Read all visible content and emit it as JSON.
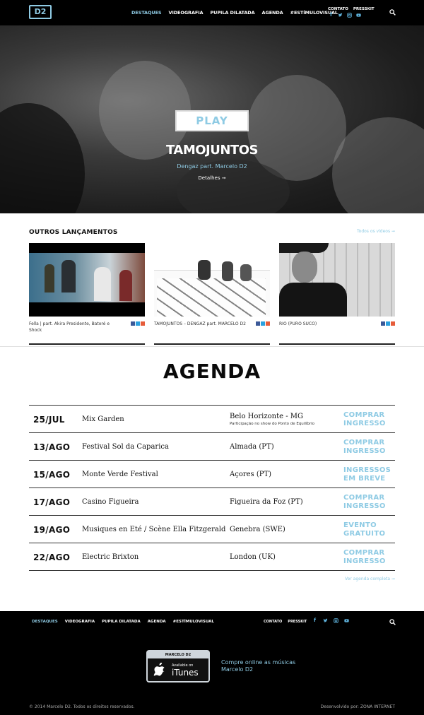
{
  "header": {
    "logo_text": "D2",
    "nav": [
      "DESTAQUES",
      "VIDEOGRAFIA",
      "PUPILA DILATADA",
      "AGENDA",
      "#ESTÍMULOVISUAL"
    ],
    "active_nav": "DESTAQUES",
    "links": [
      "CONTATO",
      "PRESSKIT"
    ],
    "social_icons": [
      "facebook-icon",
      "twitter-icon",
      "instagram-icon",
      "youtube-icon"
    ]
  },
  "hero": {
    "play_label": "PLAY",
    "title": "TAMOJUNTOS",
    "subtitle": "Dengaz part. Marcelo D2",
    "details_link": "Detalhes ➞"
  },
  "releases": {
    "title": "OUTROS LANÇAMENTOS",
    "all_link": "Todos os vídeos ➞",
    "items": [
      {
        "caption": "Fella | part. Akira Presidente, Batoré e Shock"
      },
      {
        "caption": "TAMOJUNTOS – DENGAZ part. MARCELO D2"
      },
      {
        "caption": "RIO (PURO SUCO)"
      }
    ]
  },
  "agenda": {
    "title": "AGENDA",
    "rows": [
      {
        "date": "25/JUL",
        "event": "Mix Garden",
        "city": "Belo Horizonte - MG",
        "note": "Participação no show do Ponto de Equilíbrio",
        "action": "COMPRAR INGRESSO"
      },
      {
        "date": "13/AGO",
        "event": "Festival Sol da Caparica",
        "city": "Almada (PT)",
        "note": "",
        "action": "COMPRAR INGRESSO"
      },
      {
        "date": "15/AGO",
        "event": "Monte Verde Festival",
        "city": "Açores (PT)",
        "note": "",
        "action": "INGRESSOS EM BREVE"
      },
      {
        "date": "17/AGO",
        "event": "Casino Figueira",
        "city": "Figueira da Foz (PT)",
        "note": "",
        "action": "COMPRAR INGRESSO"
      },
      {
        "date": "19/AGO",
        "event": "Musiques en Eté / Scène Ella Fitzgerald",
        "city": "Genebra (SWE)",
        "note": "",
        "action": "EVENTO GRATUITO"
      },
      {
        "date": "22/AGO",
        "event": "Electric Brixton",
        "city": "London (UK)",
        "note": "",
        "action": "COMPRAR INGRESSO"
      }
    ],
    "more_link": "Ver agenda completa ➞"
  },
  "footer": {
    "nav": [
      "DESTAQUES",
      "VIDEOGRAFIA",
      "PUPILA DILATADA",
      "AGENDA",
      "#ESTÍMULOVISUAL"
    ],
    "links": [
      "CONTATO",
      "PRESSKIT"
    ],
    "itunes_band": "MARCELO D2",
    "itunes_available": "Available on",
    "itunes_name": "iTunes",
    "buy_text": "Compre online as músicas Marcelo D2",
    "copyright": "© 2014 Marcelo D2. Todos os direitos reservados.",
    "credits": "Desenvolvido por: ZONA INTERNET"
  },
  "colors": {
    "accent": "#8fcbe4",
    "background_dark": "#000000",
    "background_light": "#ffffff"
  }
}
